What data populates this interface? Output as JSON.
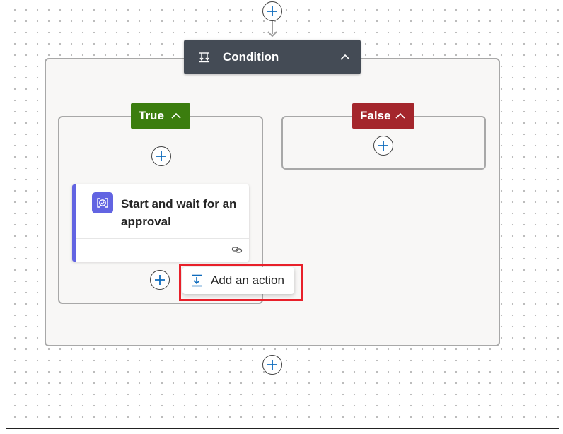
{
  "condition": {
    "label": "Condition",
    "icon": "condition-icon",
    "collapse_icon": "chevron-up-icon",
    "header_color": "#444b55"
  },
  "branches": {
    "true": {
      "label": "True",
      "color": "#3b7d0e",
      "collapse_icon": "chevron-up-icon"
    },
    "false": {
      "label": "False",
      "color": "#a4262c",
      "collapse_icon": "chevron-up-icon"
    }
  },
  "approval_action": {
    "title": "Start and wait for an approval",
    "icon": "approvals-icon",
    "accent_color": "#6264e2",
    "footer_icon": "link-icon"
  },
  "add_action_menu": {
    "label": "Add an action",
    "icon": "add-action-icon",
    "highlight_color": "#e8202a"
  },
  "insert_buttons": [
    {
      "id": "insert-top",
      "icon": "plus-icon"
    },
    {
      "id": "insert-true-top",
      "icon": "plus-icon"
    },
    {
      "id": "insert-false",
      "icon": "plus-icon"
    },
    {
      "id": "insert-true-bottom",
      "icon": "plus-icon"
    },
    {
      "id": "insert-after-condition",
      "icon": "plus-icon"
    }
  ],
  "colors": {
    "plus_accent": "#0f6cbd",
    "scope_background": "#f8f7f6",
    "scope_border": "#a8a8a8",
    "connector": "#a0a0a0"
  }
}
